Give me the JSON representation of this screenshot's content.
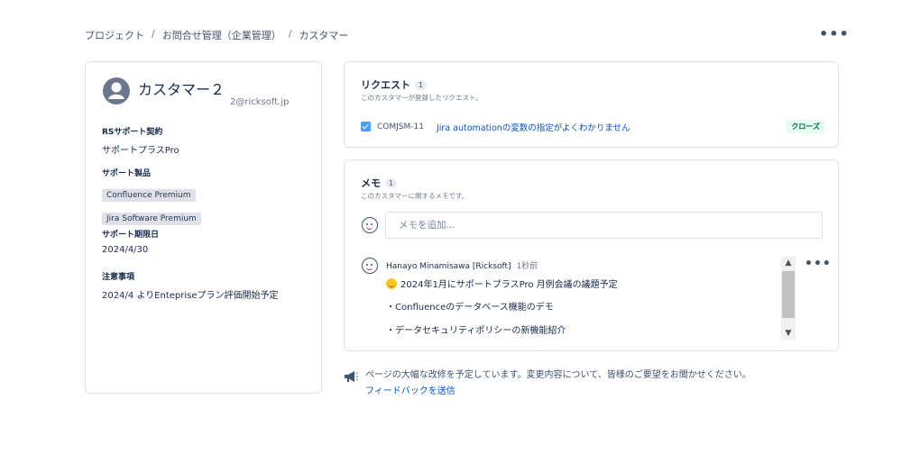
{
  "breadcrumb": [
    "プロジェクト",
    "お問合せ管理（企業管理）",
    "カスタマー"
  ],
  "breadcrumb_sep": "/",
  "top_more": "•••",
  "customer": {
    "name": "カスタマー２",
    "email": "2@ricksoft.jp",
    "fields": {
      "contract_label": "RSサポート契約",
      "contract_value": "サポートプラスPro",
      "products_label": "サポート製品",
      "products": [
        "Confluence Premium",
        "Jira Software Premium"
      ],
      "period_label": "サポート期限日",
      "period_value": "2024/4/30",
      "notes_label": "注意事項",
      "notes_value": "2024/4 よりEntepriseプラン評価開始予定"
    }
  },
  "requests": {
    "title": "リクエスト",
    "count": "1",
    "subtitle": "このカスタマーが登録したリクエスト。",
    "items": [
      {
        "key": "COMJSM-11",
        "summary": "Jira automationの変数の指定がよくわかりません",
        "status": "クローズ"
      }
    ]
  },
  "memo": {
    "title": "メモ",
    "count": "1",
    "subtitle": "このカスタマーに関するメモです。",
    "placeholder": "メモを追加...",
    "comment": {
      "author": "Hanayo Minamisawa [Ricksoft]",
      "time": "1秒前",
      "lines": [
        "2024年1月にサポートプラスPro 月例会議の議題予定",
        "・Confluenceのデータベース機能のデモ",
        "・データセキュリティポリシーの新機能紹介"
      ],
      "more": "•••"
    }
  },
  "feedback": {
    "message": "ページの大幅な改修を予定しています。変更内容について、皆様のご要望をお聞かせください。",
    "link": "フィードバックを送信"
  },
  "colors": {
    "link": "#0052cc",
    "status_bg": "#e3fcef",
    "status_fg": "#006644",
    "checkbox": "#4c9aff"
  }
}
